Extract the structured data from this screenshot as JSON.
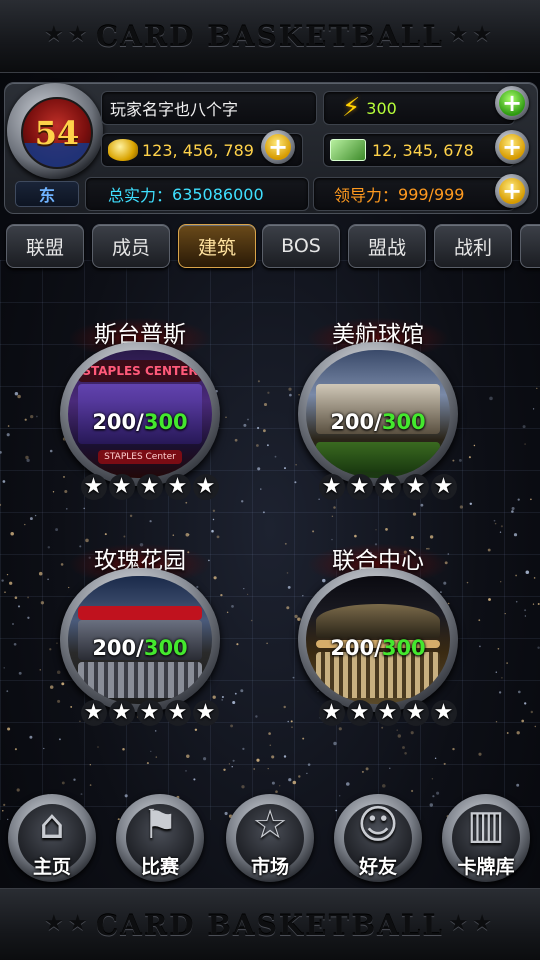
{
  "header": {
    "title": "CARD BASKETBALL",
    "stars_left": "★★",
    "stars_right": "★★"
  },
  "player": {
    "level": "54",
    "region": "东",
    "name": "玩家名字也八个字",
    "energy": "300",
    "gold": "123, 456, 789",
    "cash": "12, 345, 678",
    "power_label": "总实力：",
    "power_value": "635086000",
    "leadership_label": "领导力：",
    "leadership_value": "999/999"
  },
  "tabs": [
    {
      "label": "联盟"
    },
    {
      "label": "成员"
    },
    {
      "label": "建筑"
    },
    {
      "label": "BOS"
    },
    {
      "label": "盟战"
    },
    {
      "label": "战利"
    }
  ],
  "buildings": [
    {
      "name": "斯台普斯",
      "current": "200",
      "sep": "/",
      "max": "300",
      "stars": 5,
      "sign": "STAPLES Center"
    },
    {
      "name": "美航球馆",
      "current": "200",
      "sep": "/",
      "max": "300",
      "stars": 5,
      "sign": ""
    },
    {
      "name": "玫瑰花园",
      "current": "200",
      "sep": "/",
      "max": "300",
      "stars": 5,
      "sign": ""
    },
    {
      "name": "联合中心",
      "current": "200",
      "sep": "/",
      "max": "300",
      "stars": 5,
      "sign": ""
    }
  ],
  "nav": [
    {
      "label": "主页",
      "icon": "home-icon",
      "glyph": "⌂"
    },
    {
      "label": "比赛",
      "icon": "flag-icon",
      "glyph": "⚑"
    },
    {
      "label": "市场",
      "icon": "star-icon",
      "glyph": "☆"
    },
    {
      "label": "好友",
      "icon": "friends-icon",
      "glyph": "☺"
    },
    {
      "label": "卡牌库",
      "icon": "cards-icon",
      "glyph": "▥"
    }
  ],
  "footer": {
    "title": "CARD BASKETBALL",
    "stars_left": "★★",
    "stars_right": "★★"
  },
  "colors": {
    "accent_green": "#44e82e",
    "gold": "#ffd24a",
    "cyan": "#3fe0ff",
    "orange": "#ff9a1f"
  }
}
